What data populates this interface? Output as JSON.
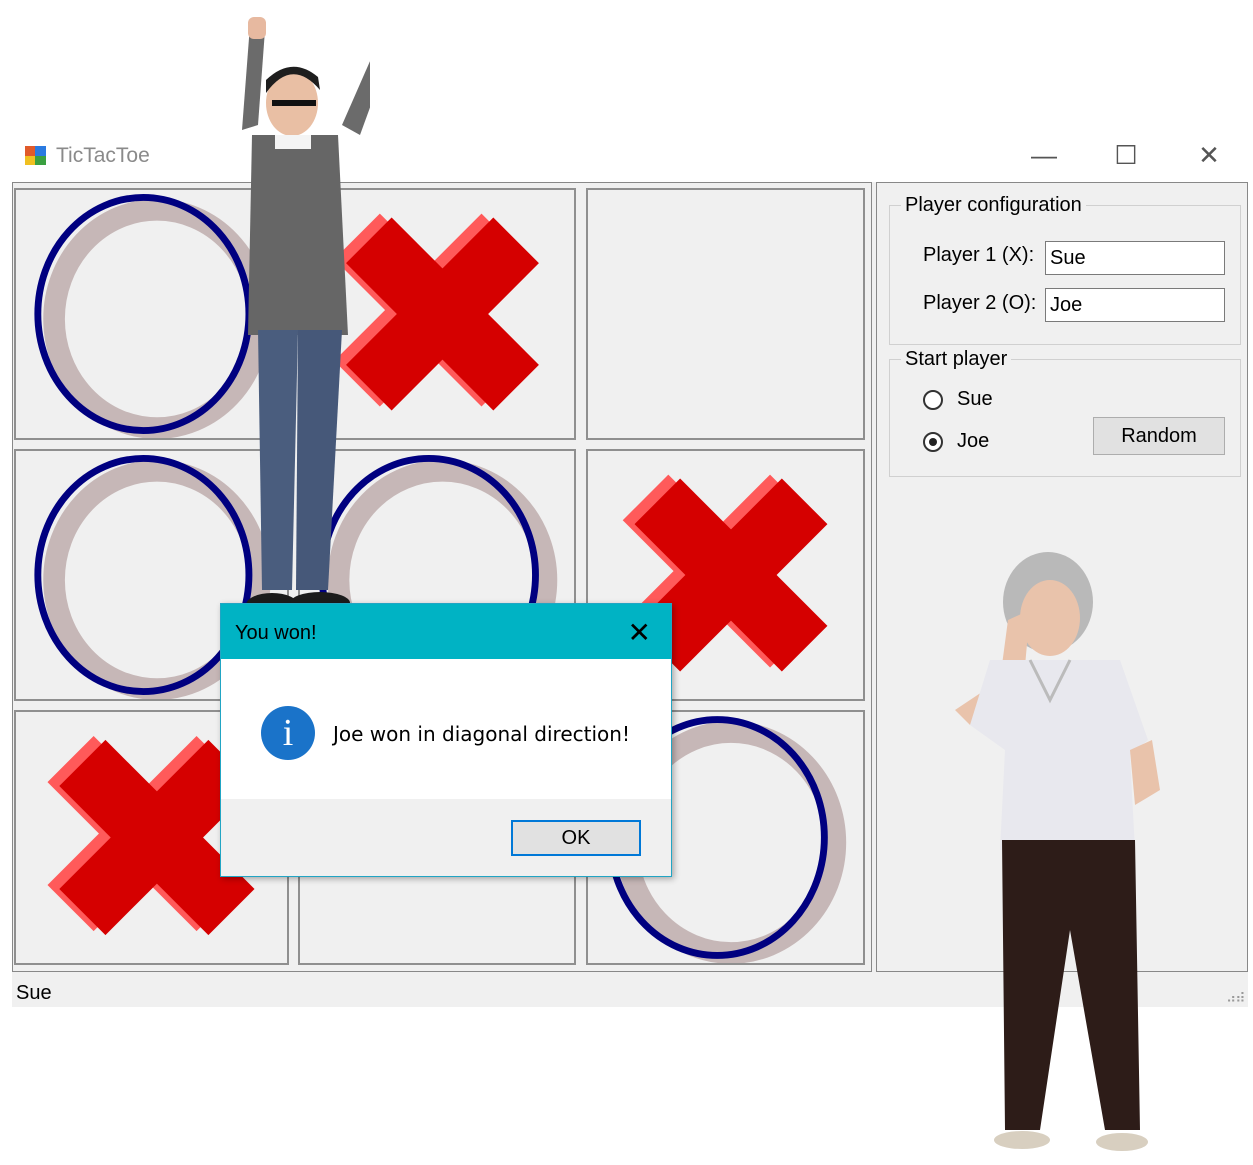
{
  "window": {
    "title": "TicTacToe",
    "minimize_glyph": "—",
    "maximize_glyph": "☐",
    "close_glyph": "✕"
  },
  "board": {
    "cells": [
      "O",
      "X",
      "",
      "O",
      "O",
      "X",
      "X",
      "",
      "O"
    ]
  },
  "player_configuration": {
    "title": "Player configuration",
    "player1_label": "Player 1 (X):",
    "player1_value": "Sue",
    "player2_label": "Player 2 (O):",
    "player2_value": "Joe"
  },
  "start_player": {
    "title": "Start player",
    "options": [
      "Sue",
      "Joe"
    ],
    "selected": "Joe",
    "random_label": "Random"
  },
  "status_bar": {
    "text": "Sue",
    "grip_glyph": "⣠⣴"
  },
  "dialog": {
    "title": "You won!",
    "close_glyph": "✕",
    "message": "Joe won in diagonal direction!",
    "icon_glyph": "i",
    "ok_label": "OK"
  },
  "colors": {
    "o_ring": "#000080",
    "o_shadow": "#c6b7b7",
    "x_main": "#d50000",
    "x_shadow": "#ff5a5a",
    "dialog_title_bar": "#00b3c4",
    "info_icon": "#1a73c9"
  }
}
